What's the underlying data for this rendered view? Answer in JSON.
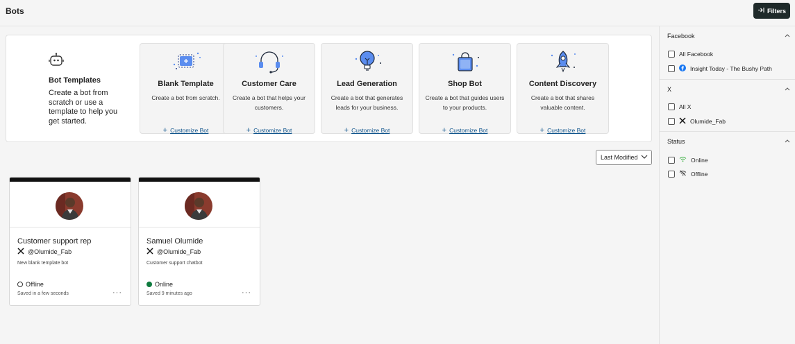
{
  "header": {
    "title": "Bots",
    "filters_label": "Filters"
  },
  "intro": {
    "title": "Bot Templates",
    "text": "Create a bot from scratch or use a template to help you get started."
  },
  "templates": [
    {
      "name": "Blank Template",
      "desc": "Create a bot from scratch.",
      "link": "Customize Bot",
      "icon": "blank-template-icon"
    },
    {
      "name": "Customer Care",
      "desc": "Create a bot that helps your customers.",
      "link": "Customize Bot",
      "icon": "headset-icon"
    },
    {
      "name": "Lead Generation",
      "desc": "Create a bot that generates leads for your business.",
      "link": "Customize Bot",
      "icon": "lightbulb-icon"
    },
    {
      "name": "Shop Bot",
      "desc": "Create a bot that guides users to your products.",
      "link": "Customize Bot",
      "icon": "shopping-bag-icon"
    },
    {
      "name": "Content Discovery",
      "desc": "Create a bot that shares valuable content.",
      "link": "Customize Bot",
      "icon": "rocket-icon"
    }
  ],
  "sort": {
    "label": "Last Modified"
  },
  "bots": [
    {
      "name": "Customer support rep",
      "handle": "@Olumide_Fab",
      "desc": "New blank template bot",
      "status": "Offline",
      "status_color": "#ffffff",
      "saved": "Saved  in a few seconds"
    },
    {
      "name": "Samuel Olumide",
      "handle": "@Olumide_Fab",
      "desc": "Customer support chatbot",
      "status": "Online",
      "status_color": "#0e7a3e",
      "saved": "Saved  9 minutes ago"
    }
  ],
  "filters": {
    "facebook": {
      "title": "Facebook",
      "options": [
        "All Facebook",
        "Insight Today - The Bushy Path"
      ]
    },
    "x": {
      "title": "X",
      "options": [
        "All X",
        "Olumide_Fab"
      ]
    },
    "status": {
      "title": "Status",
      "options": [
        "Online",
        "Offline"
      ]
    }
  },
  "colors": {
    "accent": "#0f548c",
    "icon_blue": "#3b82f6",
    "dark": "#1f2a2a"
  }
}
